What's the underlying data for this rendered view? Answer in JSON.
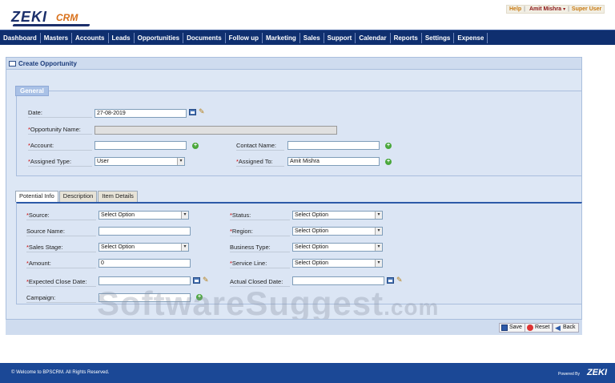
{
  "app": {
    "logo_main": "ZEKI",
    "logo_sub": "CRM"
  },
  "userbar": {
    "help": "Help",
    "user": "Amit Mishra",
    "separator": "|",
    "role": "Super User"
  },
  "nav": {
    "items": [
      "Dashboard",
      "Masters",
      "Accounts",
      "Leads",
      "Opportunities",
      "Documents",
      "Follow up",
      "Marketing",
      "Sales",
      "Support",
      "Calendar",
      "Reports",
      "Settings",
      "Expense"
    ]
  },
  "panel": {
    "title": "Create Opportunity"
  },
  "general": {
    "legend": "General",
    "date_label": "Date:",
    "date_value": "27-08-2019",
    "opportunity_name_label": "Opportunity Name:",
    "account_label": "Account:",
    "contact_name_label": "Contact Name:",
    "assigned_type_label": "Assigned Type:",
    "assigned_type_value": "User",
    "assigned_to_label": "Assigned To:",
    "assigned_to_value": "Amit Mishra",
    "required_mark": "*"
  },
  "tabs": [
    "Potential Info",
    "Description",
    "Item Details"
  ],
  "potential": {
    "source_label": "Source:",
    "source_value": "Select Option",
    "status_label": "Status:",
    "status_value": "Select Option",
    "source_name_label": "Source Name:",
    "region_label": "Region:",
    "region_value": "Select Option",
    "sales_stage_label": "Sales Stage:",
    "sales_stage_value": "Select Option",
    "business_type_label": "Business Type:",
    "business_type_value": "Select Option",
    "amount_label": "Amount:",
    "amount_value": "0",
    "service_line_label": "Service Line:",
    "service_line_value": "Select Option",
    "expected_close_label": "Expected Close Date:",
    "actual_closed_label": "Actual Closed Date:",
    "campaign_label": "Campaign:"
  },
  "actions": {
    "save": "Save",
    "reset": "Reset",
    "back": "Back"
  },
  "watermark": {
    "main": "SoftwareSuggest",
    "suffix": ".com"
  },
  "footer": {
    "copyright": "© Welcome to BPSCRM. All Rights Reserved.",
    "powered": "Powered By",
    "powered_logo": "ZEKI"
  },
  "colors": {
    "nav_bg": "#0f2f6f",
    "footer_bg": "#1b4896",
    "panel_bg": "#dde7f5",
    "required": "#cc0000",
    "accent_orange": "#d8701a"
  }
}
